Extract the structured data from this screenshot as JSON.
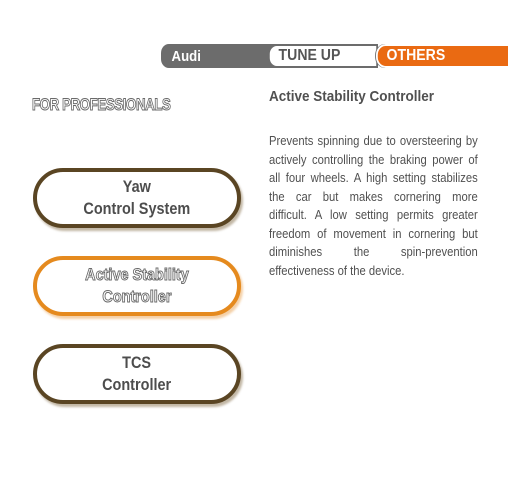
{
  "tabs": {
    "make": "Audi",
    "tune_up": "TUNE UP",
    "others": "OTHERS"
  },
  "section": {
    "heading": "FOR PROFESSIONALS"
  },
  "options": [
    {
      "label": "Yaw\nControl System",
      "state": "normal"
    },
    {
      "label": "Active Stability\nController",
      "state": "selected"
    },
    {
      "label": "TCS\nController",
      "state": "normal"
    }
  ],
  "description": {
    "title": "Active Stability Controller",
    "body": "Prevents spinning due to oversteering by actively controlling the braking power of all four wheels. A high setting stabilizes the car but makes cornering more difficult. A low setting permits greater freedom of movement in cornering but diminishes the spin-prevention effectiveness of the device."
  },
  "colors": {
    "accent": "#ea6a12",
    "selected_border": "#e58a1e",
    "button_border": "#5a4523",
    "tab_gray": "#6c6c6c",
    "text": "#505050"
  }
}
